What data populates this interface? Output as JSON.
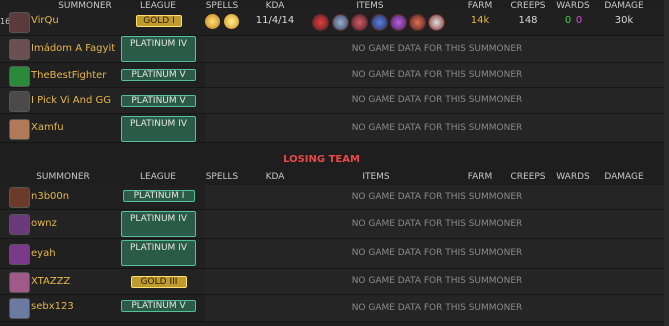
{
  "winning_header": {
    "summoner": "SUMMONER",
    "league": "LEAGUE",
    "spells": "SPELLS",
    "kda": "KDA",
    "items": "ITEMS",
    "farm": "FARM",
    "creeps": "CREEPS",
    "wards": "WARDS",
    "damage": "DAMAGE"
  },
  "winning_team": [
    {
      "num": "16",
      "name": "VirQu",
      "league": "GOLD I",
      "tier": "gold",
      "kda": "11/4/14",
      "farm": "14k",
      "creeps": "148",
      "wards_a": "0",
      "wards_b": "0",
      "damage": "30k",
      "avatar": "#5a3a3a"
    },
    {
      "name": "Imádom A Fagyit",
      "league": "PLATINUM IV",
      "tier": "plat",
      "nodata": "NO GAME DATA FOR THIS SUMMONER",
      "avatar": "#6a5050"
    },
    {
      "name": "TheBestFighter",
      "league": "PLATINUM V",
      "tier": "plat",
      "nodata": "NO GAME DATA FOR THIS SUMMONER",
      "avatar": "#2a8a3a"
    },
    {
      "name": "I Pick Vi And GG",
      "league": "PLATINUM V",
      "tier": "plat",
      "nodata": "NO GAME DATA FOR THIS SUMMONER",
      "avatar": "#4a4a4a"
    },
    {
      "name": "Xamfu",
      "league": "PLATINUM IV",
      "tier": "plat",
      "nodata": "NO GAME DATA FOR THIS SUMMONER",
      "avatar": "#b07a5a"
    }
  ],
  "losing_title": "LOSING TEAM",
  "losing_header": {
    "summoner": "SUMMONER",
    "league": "LEAGUE",
    "spells": "SPELLS",
    "kda": "KDA",
    "items": "ITEMS",
    "farm": "FARM",
    "creeps": "CREEPS",
    "wards": "WARDS",
    "damage": "DAMAGE"
  },
  "losing_team": [
    {
      "name": "n3b00n",
      "league": "PLATINUM I",
      "tier": "plat",
      "nodata": "NO GAME DATA FOR THIS SUMMONER",
      "avatar": "#6a3a2a"
    },
    {
      "name": "ownz",
      "league": "PLATINUM IV",
      "tier": "plat",
      "nodata": "NO GAME DATA FOR THIS SUMMONER",
      "avatar": "#6a3a7a"
    },
    {
      "name": "eyah",
      "league": "PLATINUM IV",
      "tier": "plat",
      "nodata": "NO GAME DATA FOR THIS SUMMONER",
      "avatar": "#7a3a8a"
    },
    {
      "name": "XTAZZZ",
      "league": "GOLD III",
      "tier": "gold",
      "nodata": "NO GAME DATA FOR THIS SUMMONER",
      "avatar": "#a05a8a"
    },
    {
      "name": "sebx123",
      "league": "PLATINUM V",
      "tier": "plat",
      "nodata": "NO GAME DATA FOR THIS SUMMONER",
      "avatar": "#6a7aa0"
    }
  ],
  "spell_icons": [
    "ignite-spell-icon",
    "flash-spell-icon"
  ],
  "item_icons": [
    "boots-item-icon",
    "sword-item-icon",
    "armor-item-icon",
    "blade-item-icon",
    "orb-item-icon",
    "cleaver-item-icon",
    "trinket-item-icon"
  ],
  "colors": {
    "gold_name": "#e6b64a",
    "losing": "#e84848",
    "ward_green": "#4ccb4c",
    "ward_pink": "#d84cd8"
  }
}
